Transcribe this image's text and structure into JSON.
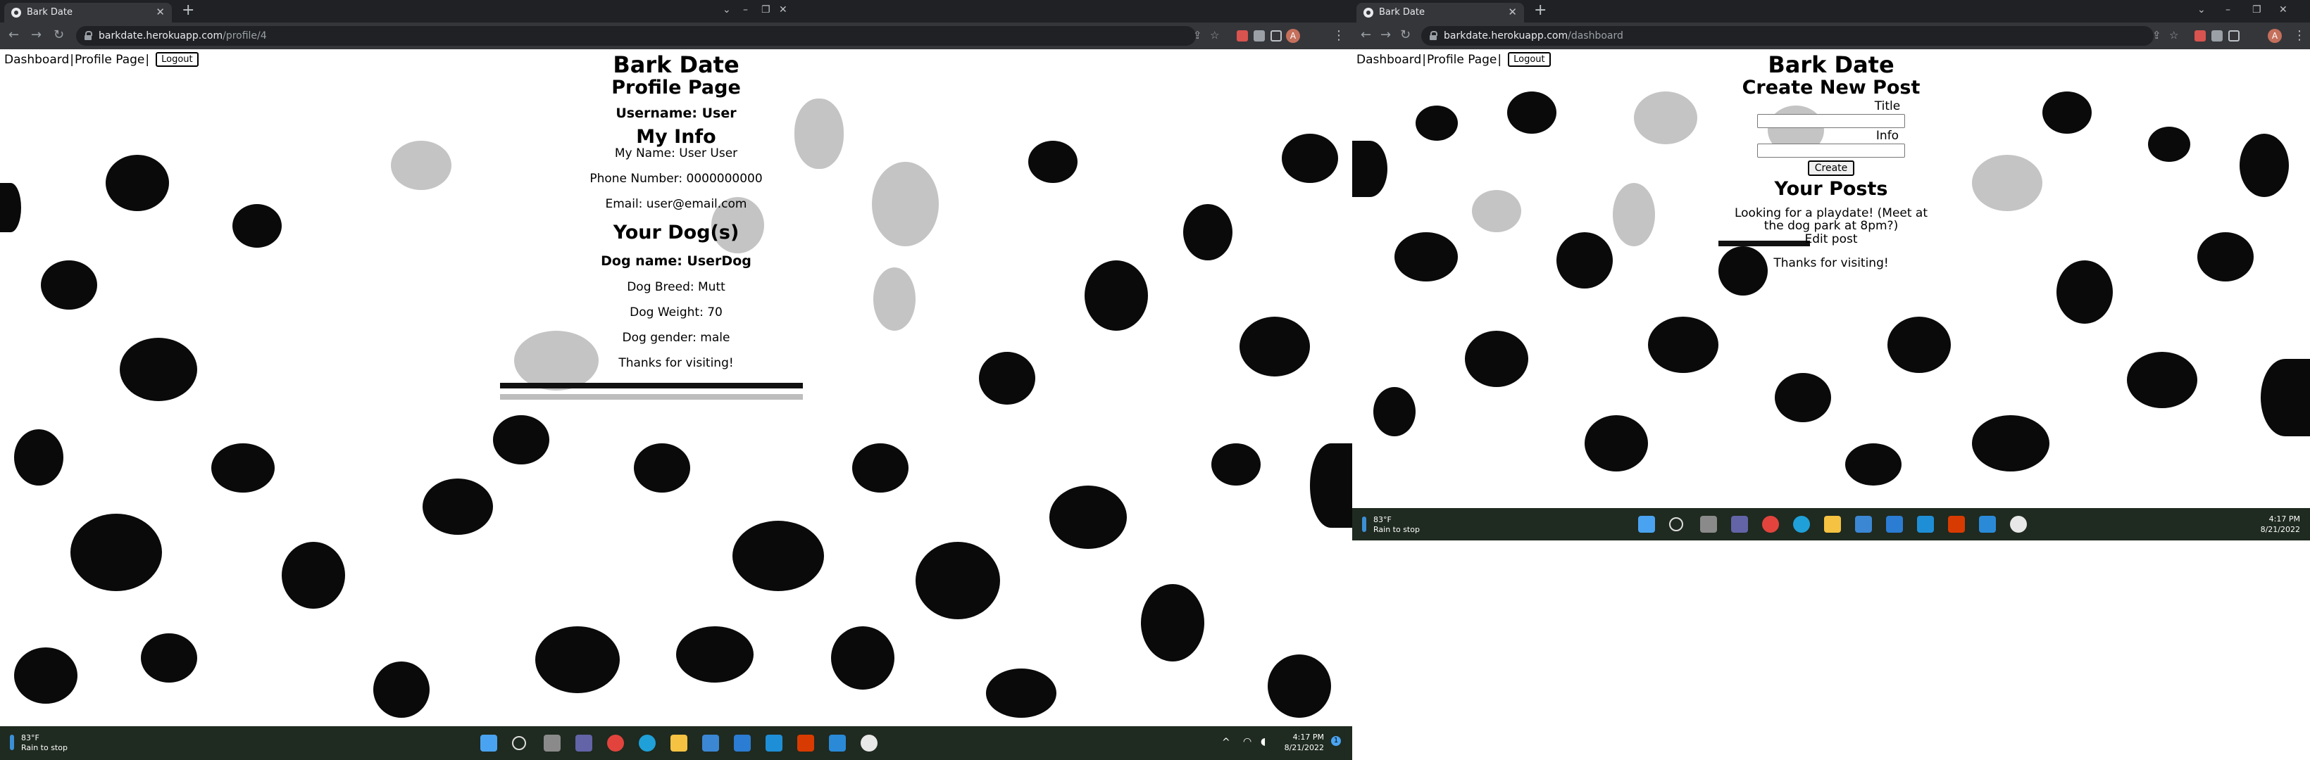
{
  "browser": {
    "tab_title": "Bark Date",
    "new_tab": "+",
    "window_controls": {
      "minimize": "–",
      "restore": "❐",
      "close": "✕"
    }
  },
  "left": {
    "url_host": "barkdate.herokuapp.com",
    "url_path": "/profile/4",
    "nav": {
      "dashboard": "Dashboard",
      "profile": "Profile Page",
      "logout": "Logout"
    },
    "page": {
      "site_title": "Bark Date",
      "page_title": "Profile Page",
      "username": "Username: User",
      "info_heading": "My Info",
      "name": "My Name: User User",
      "phone": "Phone Number: 0000000000",
      "email": "Email: user@email.com",
      "dogs_heading": "Your Dog(s)",
      "dog_name": "Dog name: UserDog",
      "dog_breed": "Dog Breed: Mutt",
      "dog_weight": "Dog Weight: 70",
      "dog_gender": "Dog gender: male",
      "footer": "Thanks for visiting!"
    }
  },
  "right": {
    "url_host": "barkdate.herokuapp.com",
    "url_path": "/dashboard",
    "nav": {
      "dashboard": "Dashboard",
      "profile": "Profile Page",
      "logout": "Logout"
    },
    "page": {
      "site_title": "Bark Date",
      "create_heading": "Create New Post",
      "title_label": "Title",
      "info_label": "Info",
      "create_button": "Create",
      "posts_heading": "Your Posts",
      "post_text": "Looking for a playdate! (Meet at the dog park at 8pm?)",
      "edit_link": "Edit post",
      "footer": "Thanks for visiting!"
    }
  },
  "taskbar": {
    "weather_temp": "83°F",
    "weather_desc": "Rain to stop",
    "time": "4:17 PM",
    "date": "8/21/2022",
    "notification_count": "1"
  },
  "colors": {
    "chrome_dark": "#202124",
    "chrome_toolbar": "#35363a",
    "taskbar": "#1f2a20",
    "spot": "#0a0a0a",
    "faded_spot": "#c4c4c4"
  }
}
